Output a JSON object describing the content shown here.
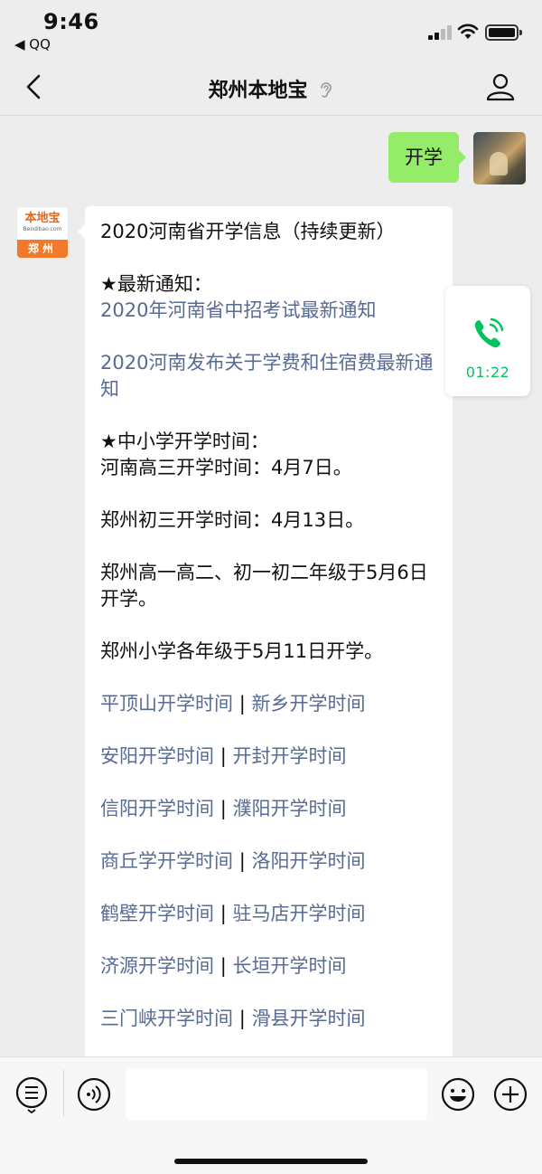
{
  "status_bar": {
    "time": "9:46",
    "back_app": "◀ QQ",
    "battery_level": 0.9
  },
  "nav": {
    "title": "郑州本地宝",
    "back_icon": "chevron-left-icon",
    "mute_icon": "ear-icon",
    "profile_icon": "person-icon"
  },
  "outgoing_message": {
    "text": "开学"
  },
  "bot": {
    "avatar_brand": "本地宝",
    "avatar_domain": "Bendibao.com",
    "avatar_city": "郑州"
  },
  "reply": {
    "title": "2020河南省开学信息（持续更新）",
    "section1_heading": "★最新通知：",
    "notice_links": [
      "2020年河南省中招考试最新通知",
      "2020河南发布关于学费和住宿费最新通知"
    ],
    "section2_heading": "★中小学开学时间：",
    "schedule": [
      "河南高三开学时间：4月7日。",
      "郑州初三开学时间：4月13日。",
      "郑州高一高二、初一初二年级于5月6日开学。",
      "郑州小学各年级于5月11日开学。"
    ],
    "separator": "|",
    "city_links": [
      [
        "平顶山开学时间",
        "新乡开学时间"
      ],
      [
        "安阳开学时间",
        "开封开学时间"
      ],
      [
        "信阳开学时间",
        "濮阳开学时间"
      ],
      [
        "商丘学开学时间",
        "洛阳开学时间"
      ],
      [
        "鹤壁开学时间",
        "驻马店开学时间"
      ],
      [
        "济源开学时间",
        "长垣开学时间"
      ],
      [
        "三门峡开学时间",
        "滑县开学时间"
      ]
    ]
  },
  "call_widget": {
    "duration": "01:22",
    "icon": "phone-icon",
    "color": "#07c160"
  },
  "input_bar": {
    "menu_icon": "menu-list-icon",
    "voice_icon": "voice-icon",
    "emoji_icon": "emoji-icon",
    "plus_icon": "plus-icon",
    "text_value": ""
  },
  "colors": {
    "outgoing_bubble": "#95ec69",
    "link": "#576b95",
    "background": "#ededed"
  }
}
